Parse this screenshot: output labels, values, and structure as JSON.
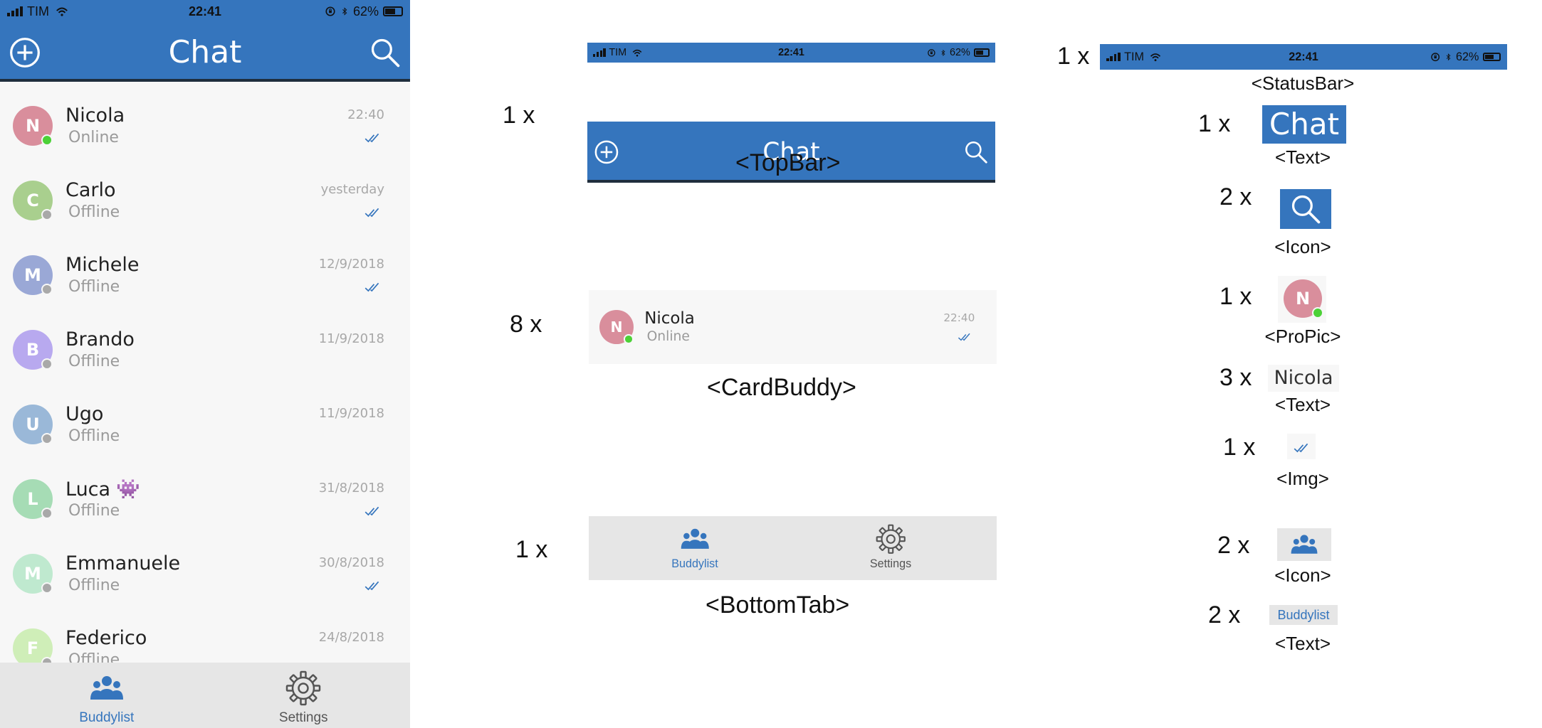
{
  "colors": {
    "brand_blue": "#3575bd",
    "online_green": "#4cd137",
    "offline_gray": "#a9a9a9",
    "tab_bg": "#e6e6e6",
    "card_bg": "#f7f7f7",
    "tab_active": "#3575bd",
    "tab_inactive": "#555555"
  },
  "phone": {
    "status_bar": {
      "carrier": "TIM",
      "time": "22:41",
      "battery": "62%",
      "battery_level": 0.62
    },
    "top_bar": {
      "title": "Chat",
      "left_icon": "add-circle-icon",
      "right_icon": "search-icon"
    },
    "buddies": [
      {
        "initial": "N",
        "name": "Nicola",
        "status": "Online",
        "date": "22:40",
        "read": true,
        "online": true,
        "color": "#d98e9c"
      },
      {
        "initial": "C",
        "name": "Carlo",
        "status": "Offline",
        "date": "yesterday",
        "read": true,
        "online": false,
        "color": "#a9cf8e"
      },
      {
        "initial": "M",
        "name": "Michele",
        "status": "Offline",
        "date": "12/9/2018",
        "read": true,
        "online": false,
        "color": "#9aa8d6"
      },
      {
        "initial": "B",
        "name": "Brando",
        "status": "Offline",
        "date": "11/9/2018",
        "read": false,
        "online": false,
        "color": "#b8a9ef"
      },
      {
        "initial": "U",
        "name": "Ugo",
        "status": "Offline",
        "date": "11/9/2018",
        "read": false,
        "online": false,
        "color": "#9ab8d8"
      },
      {
        "initial": "L",
        "name": "Luca",
        "emoji": "👾",
        "status": "Offline",
        "date": "31/8/2018",
        "read": true,
        "online": false,
        "color": "#a6dcb5"
      },
      {
        "initial": "M",
        "name": "Emmanuele",
        "status": "Offline",
        "date": "30/8/2018",
        "read": true,
        "online": false,
        "color": "#bfe9cf"
      },
      {
        "initial": "F",
        "name": "Federico",
        "status": "Offline",
        "date": "24/8/2018",
        "read": false,
        "online": false,
        "color": "#cfeeb8"
      }
    ],
    "bottom_tab": {
      "items": [
        {
          "label": "Buddylist",
          "icon": "group-icon",
          "active": true
        },
        {
          "label": "Settings",
          "icon": "gear-icon",
          "active": false
        }
      ]
    }
  },
  "components": {
    "topbar": {
      "count": "1 x",
      "label": "<TopBar>"
    },
    "cardbuddy": {
      "count": "8 x",
      "label": "<CardBuddy>",
      "example": {
        "initial": "N",
        "name": "Nicola",
        "status": "Online",
        "date": "22:40"
      }
    },
    "bottomtab": {
      "count": "1 x",
      "label": "<BottomTab>"
    }
  },
  "elements": [
    {
      "count": "1 x",
      "label": "<StatusBar>"
    },
    {
      "count": "1 x",
      "label": "<Text>",
      "sample": "Chat"
    },
    {
      "count": "2 x",
      "label": "<Icon>"
    },
    {
      "count": "1 x",
      "label": "<ProPic>",
      "sample": "N"
    },
    {
      "count": "3 x",
      "label": "<Text>",
      "sample": "Nicola"
    },
    {
      "count": "1 x",
      "label": "<Img>"
    },
    {
      "count": "2 x",
      "label": "<Icon>"
    },
    {
      "count": "2 x",
      "label": "<Text>",
      "sample": "Buddylist"
    }
  ]
}
